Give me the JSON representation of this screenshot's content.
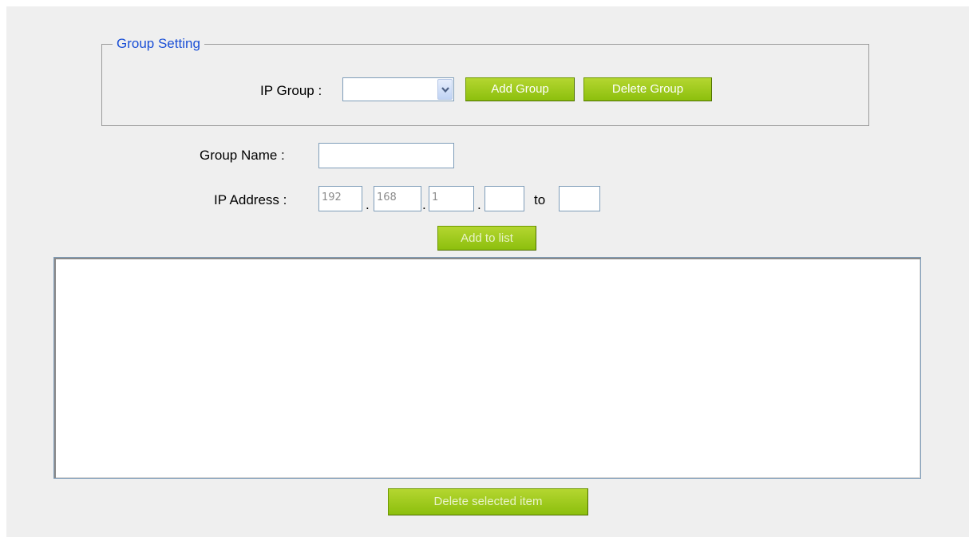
{
  "group_setting": {
    "legend": "Group Setting",
    "ip_group_label": "IP Group :",
    "ip_group_selected": "",
    "add_group_label": "Add Group",
    "delete_group_label": "Delete Group"
  },
  "form": {
    "group_name_label": "Group Name :",
    "group_name_value": "",
    "ip_address_label": "IP Address :",
    "ip_octet1": "192",
    "ip_octet2": "168",
    "ip_octet3": "1",
    "ip_octet4": "",
    "dot": ".",
    "to_label": "to",
    "ip_end": "",
    "add_to_list_label": "Add to list"
  },
  "list": {
    "items": [],
    "delete_selected_label": "Delete selected item"
  },
  "colors": {
    "legend": "#1a4fd6",
    "button_green": "#8cbf0d",
    "panel_bg": "#efefef"
  },
  "icons": {
    "dropdown": "chevron-down-icon"
  }
}
